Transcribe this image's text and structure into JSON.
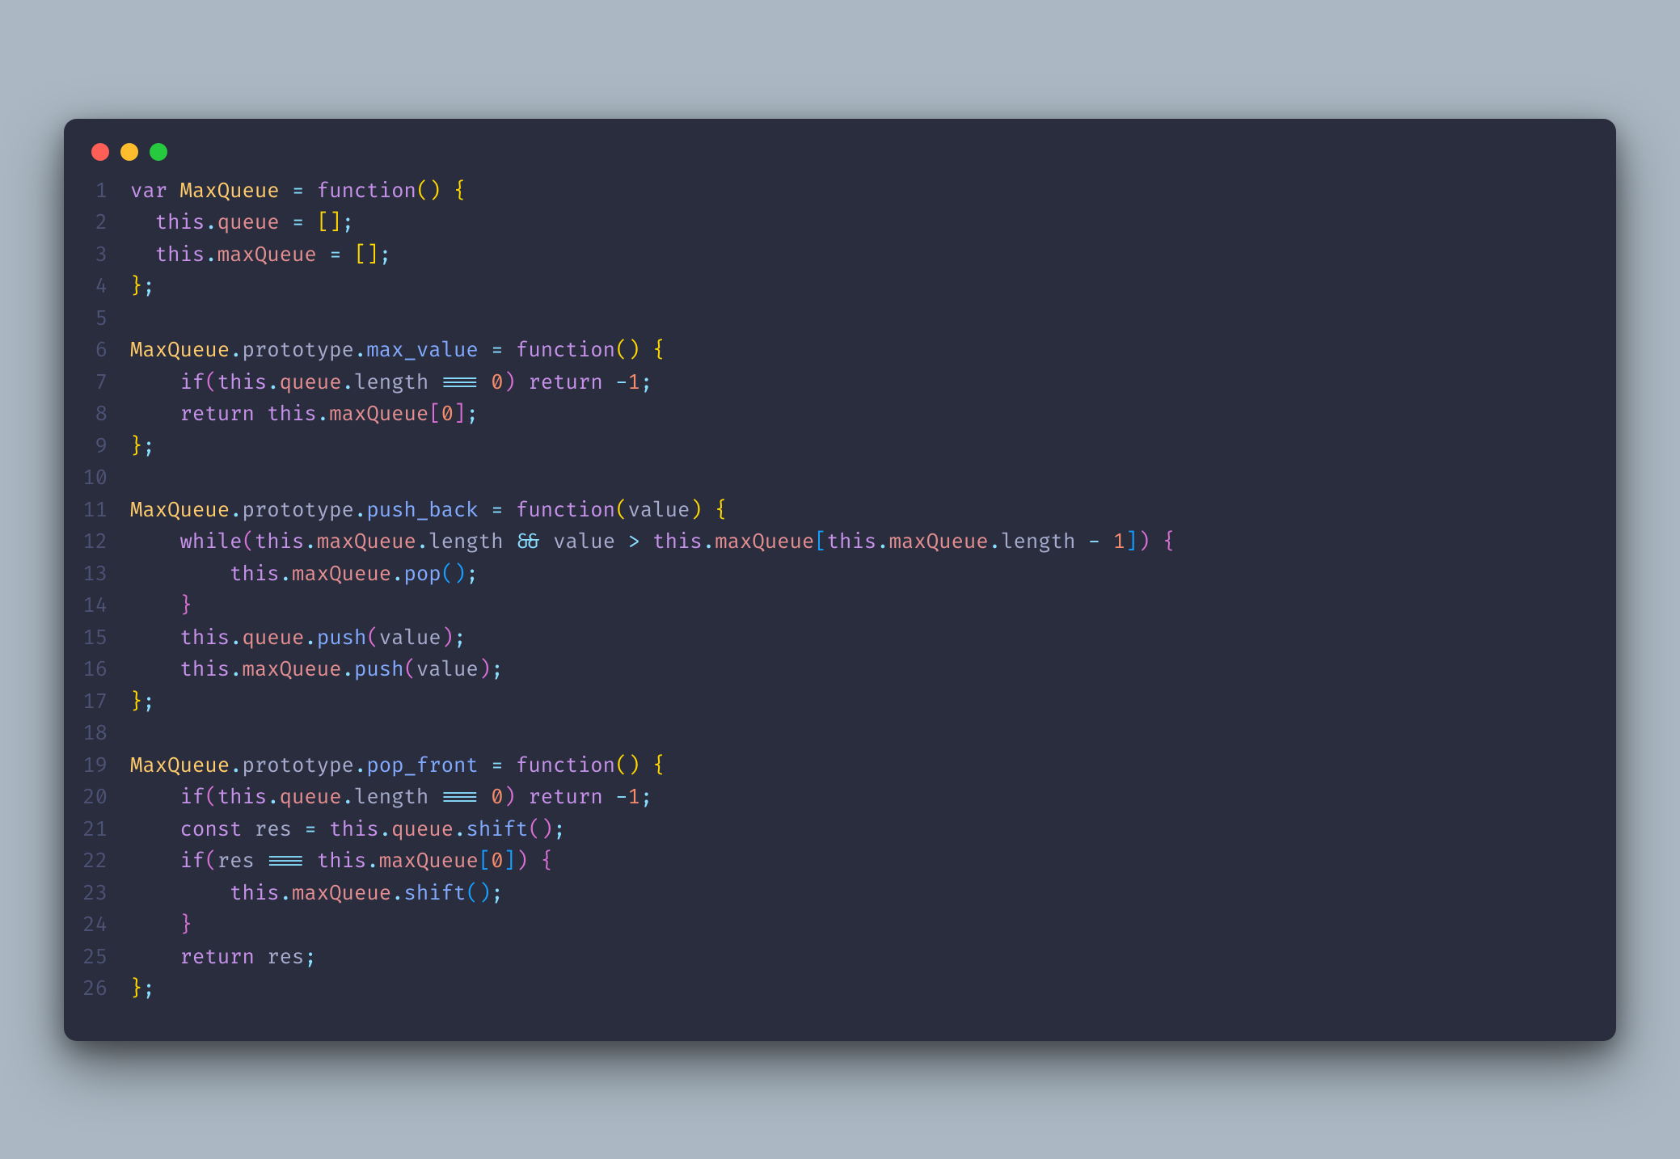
{
  "theme": {
    "name": "Material Palenight",
    "background": "#292d3e",
    "page_background": "#abb8c3",
    "gutter": "#4c5374",
    "foreground": "#a6accd",
    "keyword": "#c792ea",
    "identifier": "#ffcb6b",
    "operator": "#89ddff",
    "function": "#82aaff",
    "punctuation": "#89ddff",
    "bracket1": "#ffd700",
    "bracket2": "#da70d6",
    "bracket3": "#179fff",
    "number": "#f78c6c",
    "property": "#e48e91",
    "traffic_red": "#ff5f56",
    "traffic_yellow": "#ffbd2e",
    "traffic_green": "#27c93f"
  },
  "language": "javascript",
  "lines": [
    {
      "num": "1",
      "tokens": [
        [
          "kw",
          "var"
        ],
        [
          "pl",
          " "
        ],
        [
          "id",
          "MaxQueue"
        ],
        [
          "pl",
          " "
        ],
        [
          "op",
          "="
        ],
        [
          "pl",
          " "
        ],
        [
          "kw",
          "function"
        ],
        [
          "br",
          "("
        ],
        [
          "br",
          ")"
        ],
        [
          "pl",
          " "
        ],
        [
          "br",
          "{"
        ]
      ]
    },
    {
      "num": "2",
      "tokens": [
        [
          "pl",
          "  "
        ],
        [
          "kw",
          "this"
        ],
        [
          "pn",
          "."
        ],
        [
          "prop",
          "queue"
        ],
        [
          "pl",
          " "
        ],
        [
          "op",
          "="
        ],
        [
          "pl",
          " "
        ],
        [
          "br",
          "["
        ],
        [
          "br",
          "]"
        ],
        [
          "pn",
          ";"
        ]
      ]
    },
    {
      "num": "3",
      "tokens": [
        [
          "pl",
          "  "
        ],
        [
          "kw",
          "this"
        ],
        [
          "pn",
          "."
        ],
        [
          "prop",
          "maxQueue"
        ],
        [
          "pl",
          " "
        ],
        [
          "op",
          "="
        ],
        [
          "pl",
          " "
        ],
        [
          "br",
          "["
        ],
        [
          "br",
          "]"
        ],
        [
          "pn",
          ";"
        ]
      ]
    },
    {
      "num": "4",
      "tokens": [
        [
          "br",
          "}"
        ],
        [
          "pn",
          ";"
        ]
      ]
    },
    {
      "num": "5",
      "tokens": []
    },
    {
      "num": "6",
      "tokens": [
        [
          "id",
          "MaxQueue"
        ],
        [
          "pn",
          "."
        ],
        [
          "par",
          "prototype"
        ],
        [
          "pn",
          "."
        ],
        [
          "fn",
          "max_value"
        ],
        [
          "pl",
          " "
        ],
        [
          "op",
          "="
        ],
        [
          "pl",
          " "
        ],
        [
          "kw",
          "function"
        ],
        [
          "br",
          "("
        ],
        [
          "br",
          ")"
        ],
        [
          "pl",
          " "
        ],
        [
          "br",
          "{"
        ]
      ]
    },
    {
      "num": "7",
      "tokens": [
        [
          "pl",
          "    "
        ],
        [
          "kw",
          "if"
        ],
        [
          "br2",
          "("
        ],
        [
          "kw",
          "this"
        ],
        [
          "pn",
          "."
        ],
        [
          "prop",
          "queue"
        ],
        [
          "pn",
          "."
        ],
        [
          "par",
          "length"
        ],
        [
          "pl",
          " "
        ],
        [
          "op",
          "==="
        ],
        [
          "pl",
          " "
        ],
        [
          "num",
          "0"
        ],
        [
          "br2",
          ")"
        ],
        [
          "pl",
          " "
        ],
        [
          "kw",
          "return"
        ],
        [
          "pl",
          " "
        ],
        [
          "op",
          "-"
        ],
        [
          "num",
          "1"
        ],
        [
          "pn",
          ";"
        ]
      ]
    },
    {
      "num": "8",
      "tokens": [
        [
          "pl",
          "    "
        ],
        [
          "kw",
          "return"
        ],
        [
          "pl",
          " "
        ],
        [
          "kw",
          "this"
        ],
        [
          "pn",
          "."
        ],
        [
          "prop",
          "maxQueue"
        ],
        [
          "br2",
          "["
        ],
        [
          "num",
          "0"
        ],
        [
          "br2",
          "]"
        ],
        [
          "pn",
          ";"
        ]
      ]
    },
    {
      "num": "9",
      "tokens": [
        [
          "br",
          "}"
        ],
        [
          "pn",
          ";"
        ]
      ]
    },
    {
      "num": "10",
      "tokens": []
    },
    {
      "num": "11",
      "tokens": [
        [
          "id",
          "MaxQueue"
        ],
        [
          "pn",
          "."
        ],
        [
          "par",
          "prototype"
        ],
        [
          "pn",
          "."
        ],
        [
          "fn",
          "push_back"
        ],
        [
          "pl",
          " "
        ],
        [
          "op",
          "="
        ],
        [
          "pl",
          " "
        ],
        [
          "kw",
          "function"
        ],
        [
          "br",
          "("
        ],
        [
          "par",
          "value"
        ],
        [
          "br",
          ")"
        ],
        [
          "pl",
          " "
        ],
        [
          "br",
          "{"
        ]
      ]
    },
    {
      "num": "12",
      "tokens": [
        [
          "pl",
          "    "
        ],
        [
          "kw",
          "while"
        ],
        [
          "br2",
          "("
        ],
        [
          "kw",
          "this"
        ],
        [
          "pn",
          "."
        ],
        [
          "prop",
          "maxQueue"
        ],
        [
          "pn",
          "."
        ],
        [
          "par",
          "length"
        ],
        [
          "pl",
          " "
        ],
        [
          "op",
          "&&"
        ],
        [
          "pl",
          " "
        ],
        [
          "par",
          "value"
        ],
        [
          "pl",
          " "
        ],
        [
          "op",
          ">"
        ],
        [
          "pl",
          " "
        ],
        [
          "kw",
          "this"
        ],
        [
          "pn",
          "."
        ],
        [
          "prop",
          "maxQueue"
        ],
        [
          "br3",
          "["
        ],
        [
          "kw",
          "this"
        ],
        [
          "pn",
          "."
        ],
        [
          "prop",
          "maxQueue"
        ],
        [
          "pn",
          "."
        ],
        [
          "par",
          "length"
        ],
        [
          "pl",
          " "
        ],
        [
          "op",
          "-"
        ],
        [
          "pl",
          " "
        ],
        [
          "num",
          "1"
        ],
        [
          "br3",
          "]"
        ],
        [
          "br2",
          ")"
        ],
        [
          "pl",
          " "
        ],
        [
          "br2",
          "{"
        ]
      ]
    },
    {
      "num": "13",
      "tokens": [
        [
          "pl",
          "        "
        ],
        [
          "kw",
          "this"
        ],
        [
          "pn",
          "."
        ],
        [
          "prop",
          "maxQueue"
        ],
        [
          "pn",
          "."
        ],
        [
          "fn",
          "pop"
        ],
        [
          "br3",
          "("
        ],
        [
          "br3",
          ")"
        ],
        [
          "pn",
          ";"
        ]
      ]
    },
    {
      "num": "14",
      "tokens": [
        [
          "pl",
          "    "
        ],
        [
          "br2",
          "}"
        ]
      ]
    },
    {
      "num": "15",
      "tokens": [
        [
          "pl",
          "    "
        ],
        [
          "kw",
          "this"
        ],
        [
          "pn",
          "."
        ],
        [
          "prop",
          "queue"
        ],
        [
          "pn",
          "."
        ],
        [
          "fn",
          "push"
        ],
        [
          "br2",
          "("
        ],
        [
          "par",
          "value"
        ],
        [
          "br2",
          ")"
        ],
        [
          "pn",
          ";"
        ]
      ]
    },
    {
      "num": "16",
      "tokens": [
        [
          "pl",
          "    "
        ],
        [
          "kw",
          "this"
        ],
        [
          "pn",
          "."
        ],
        [
          "prop",
          "maxQueue"
        ],
        [
          "pn",
          "."
        ],
        [
          "fn",
          "push"
        ],
        [
          "br2",
          "("
        ],
        [
          "par",
          "value"
        ],
        [
          "br2",
          ")"
        ],
        [
          "pn",
          ";"
        ]
      ]
    },
    {
      "num": "17",
      "tokens": [
        [
          "br",
          "}"
        ],
        [
          "pn",
          ";"
        ]
      ]
    },
    {
      "num": "18",
      "tokens": []
    },
    {
      "num": "19",
      "tokens": [
        [
          "id",
          "MaxQueue"
        ],
        [
          "pn",
          "."
        ],
        [
          "par",
          "prototype"
        ],
        [
          "pn",
          "."
        ],
        [
          "fn",
          "pop_front"
        ],
        [
          "pl",
          " "
        ],
        [
          "op",
          "="
        ],
        [
          "pl",
          " "
        ],
        [
          "kw",
          "function"
        ],
        [
          "br",
          "("
        ],
        [
          "br",
          ")"
        ],
        [
          "pl",
          " "
        ],
        [
          "br",
          "{"
        ]
      ]
    },
    {
      "num": "20",
      "tokens": [
        [
          "pl",
          "    "
        ],
        [
          "kw",
          "if"
        ],
        [
          "br2",
          "("
        ],
        [
          "kw",
          "this"
        ],
        [
          "pn",
          "."
        ],
        [
          "prop",
          "queue"
        ],
        [
          "pn",
          "."
        ],
        [
          "par",
          "length"
        ],
        [
          "pl",
          " "
        ],
        [
          "op",
          "==="
        ],
        [
          "pl",
          " "
        ],
        [
          "num",
          "0"
        ],
        [
          "br2",
          ")"
        ],
        [
          "pl",
          " "
        ],
        [
          "kw",
          "return"
        ],
        [
          "pl",
          " "
        ],
        [
          "op",
          "-"
        ],
        [
          "num",
          "1"
        ],
        [
          "pn",
          ";"
        ]
      ]
    },
    {
      "num": "21",
      "tokens": [
        [
          "pl",
          "    "
        ],
        [
          "kw",
          "const"
        ],
        [
          "pl",
          " "
        ],
        [
          "par",
          "res"
        ],
        [
          "pl",
          " "
        ],
        [
          "op",
          "="
        ],
        [
          "pl",
          " "
        ],
        [
          "kw",
          "this"
        ],
        [
          "pn",
          "."
        ],
        [
          "prop",
          "queue"
        ],
        [
          "pn",
          "."
        ],
        [
          "fn",
          "shift"
        ],
        [
          "br2",
          "("
        ],
        [
          "br2",
          ")"
        ],
        [
          "pn",
          ";"
        ]
      ]
    },
    {
      "num": "22",
      "tokens": [
        [
          "pl",
          "    "
        ],
        [
          "kw",
          "if"
        ],
        [
          "br2",
          "("
        ],
        [
          "par",
          "res"
        ],
        [
          "pl",
          " "
        ],
        [
          "op",
          "==="
        ],
        [
          "pl",
          " "
        ],
        [
          "kw",
          "this"
        ],
        [
          "pn",
          "."
        ],
        [
          "prop",
          "maxQueue"
        ],
        [
          "br3",
          "["
        ],
        [
          "num",
          "0"
        ],
        [
          "br3",
          "]"
        ],
        [
          "br2",
          ")"
        ],
        [
          "pl",
          " "
        ],
        [
          "br2",
          "{"
        ]
      ]
    },
    {
      "num": "23",
      "tokens": [
        [
          "pl",
          "        "
        ],
        [
          "kw",
          "this"
        ],
        [
          "pn",
          "."
        ],
        [
          "prop",
          "maxQueue"
        ],
        [
          "pn",
          "."
        ],
        [
          "fn",
          "shift"
        ],
        [
          "br3",
          "("
        ],
        [
          "br3",
          ")"
        ],
        [
          "pn",
          ";"
        ]
      ]
    },
    {
      "num": "24",
      "tokens": [
        [
          "pl",
          "    "
        ],
        [
          "br2",
          "}"
        ]
      ]
    },
    {
      "num": "25",
      "tokens": [
        [
          "pl",
          "    "
        ],
        [
          "kw",
          "return"
        ],
        [
          "pl",
          " "
        ],
        [
          "par",
          "res"
        ],
        [
          "pn",
          ";"
        ]
      ]
    },
    {
      "num": "26",
      "tokens": [
        [
          "br",
          "}"
        ],
        [
          "pn",
          ";"
        ]
      ]
    }
  ]
}
